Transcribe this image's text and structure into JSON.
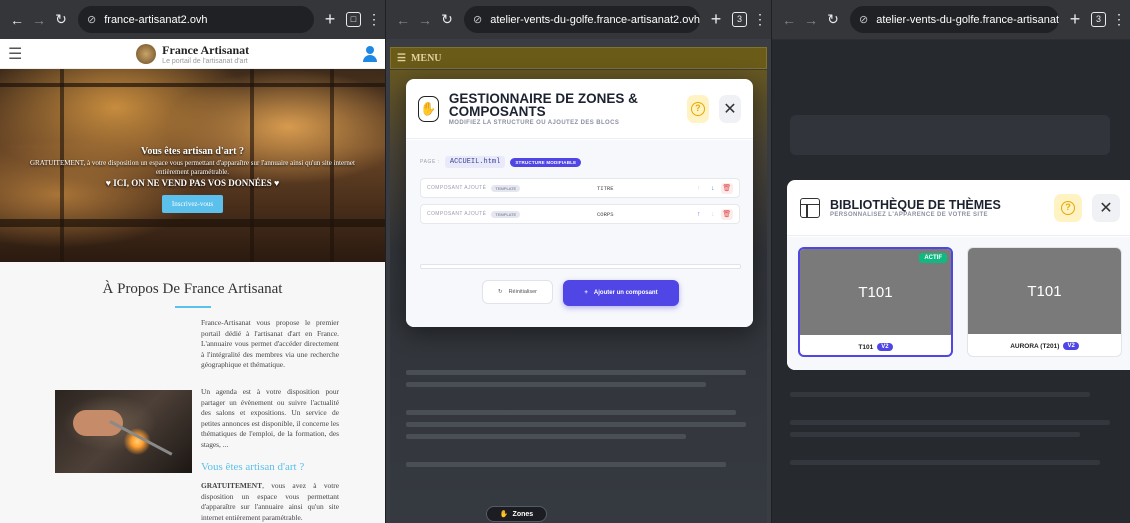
{
  "pane1": {
    "url": "france-artisanat2.ovh",
    "site_title": "France Artisanat",
    "site_tagline": "Le portail de l'artisanat d'art",
    "hero": {
      "heading": "Vous êtes artisan d'art ?",
      "text": "GRATUITEMENT, à votre disposition un espace vous permettant d'apparaître sur l'annuaire ainsi qu'un site internet entièrement paramétrable.",
      "notice": "ICI, ON NE VEND PAS VOS DONNÉES",
      "button": "Inscrivez-vous"
    },
    "about_title": "À Propos De France Artisanat",
    "para1": "France-Artisanat vous propose le premier portail dédié à l'artisanat d'art en France. L'annuaire vous permet d'accéder directement à l'intégralité des membres via une recherche géographique et thématique.",
    "para2": "Un agenda est à votre disposition pour partager un évènement ou suivre l'actualité des salons et expositions. Un service de petites annonces est disponible, il concerne les thématiques de l'emploi, de la formation, des stages, ...",
    "subtitle": "Vous êtes artisan d'art ?",
    "para3_bold": "GRATUITEMENT",
    "para3": ", vous avez à votre disposition un espace vous permettant d'apparaître sur l'annuaire ainsi qu'un site internet entièrement paramétrable."
  },
  "pane2": {
    "url": "atelier-vents-du-golfe.france-artisanat2.ovh",
    "tab_count": "3",
    "menu_label": "MENU",
    "modal": {
      "title": "GESTIONNAIRE DE ZONES & COMPOSANTS",
      "subtitle": "MODIFIEZ LA STRUCTURE OU AJOUTEZ DES BLOCS",
      "page_label": "PAGE :",
      "page_file": "ACCUEIL.html",
      "page_badge": "STRUCTURE MODIFIABLE",
      "components": [
        {
          "label": "COMPOSANT AJOUTÉ",
          "tag": "TEMPLATE",
          "name": "TITRE"
        },
        {
          "label": "COMPOSANT AJOUTÉ",
          "tag": "TEMPLATE",
          "name": "CORPS"
        }
      ],
      "reset_label": "Réinitialiser",
      "add_label": "Ajouter un composant"
    },
    "zones_label": "Zones"
  },
  "pane3": {
    "url": "atelier-vents-du-golfe.france-artisanat2.ovh",
    "tab_count": "3",
    "library": {
      "title": "BIBLIOTHÈQUE DE THÈMES",
      "subtitle": "PERSONNALISEZ L'APPARENCE DE VOTRE SITE",
      "themes": [
        {
          "thumb": "T101",
          "name": "T101",
          "version": "V2",
          "active_label": "ACTIF"
        },
        {
          "thumb": "T101",
          "name": "AURORA (T201)",
          "version": "V2"
        }
      ]
    }
  },
  "colors": {
    "accent": "#4f46e5",
    "active": "#10b981",
    "link": "#5bc0eb",
    "menu": "#6a5b19"
  }
}
